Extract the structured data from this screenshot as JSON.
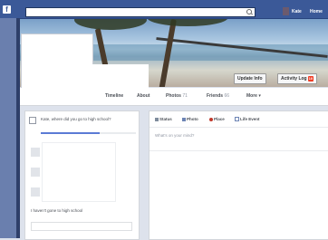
{
  "topbar": {
    "logo": "f",
    "user_name": "Kate",
    "home_label": "Home"
  },
  "cover": {
    "update_info_label": "Update Info",
    "activity_log_label": "Activity Log",
    "activity_log_count": "10"
  },
  "tabs": [
    {
      "label": "Timeline",
      "count": ""
    },
    {
      "label": "About",
      "count": ""
    },
    {
      "label": "Photos",
      "count": "71"
    },
    {
      "label": "Friends",
      "count": "66"
    },
    {
      "label": "More",
      "count": ""
    }
  ],
  "question": {
    "text": "Kate, where did you go to high school?",
    "answer_label": "I haven't gone to high school"
  },
  "composer": {
    "tabs": [
      "Status",
      "Photo",
      "Place",
      "Life Event"
    ],
    "placeholder": "What's on your mind?"
  },
  "colors": {
    "brand_blue": "#3b5998",
    "badge_red": "#f03d25"
  }
}
